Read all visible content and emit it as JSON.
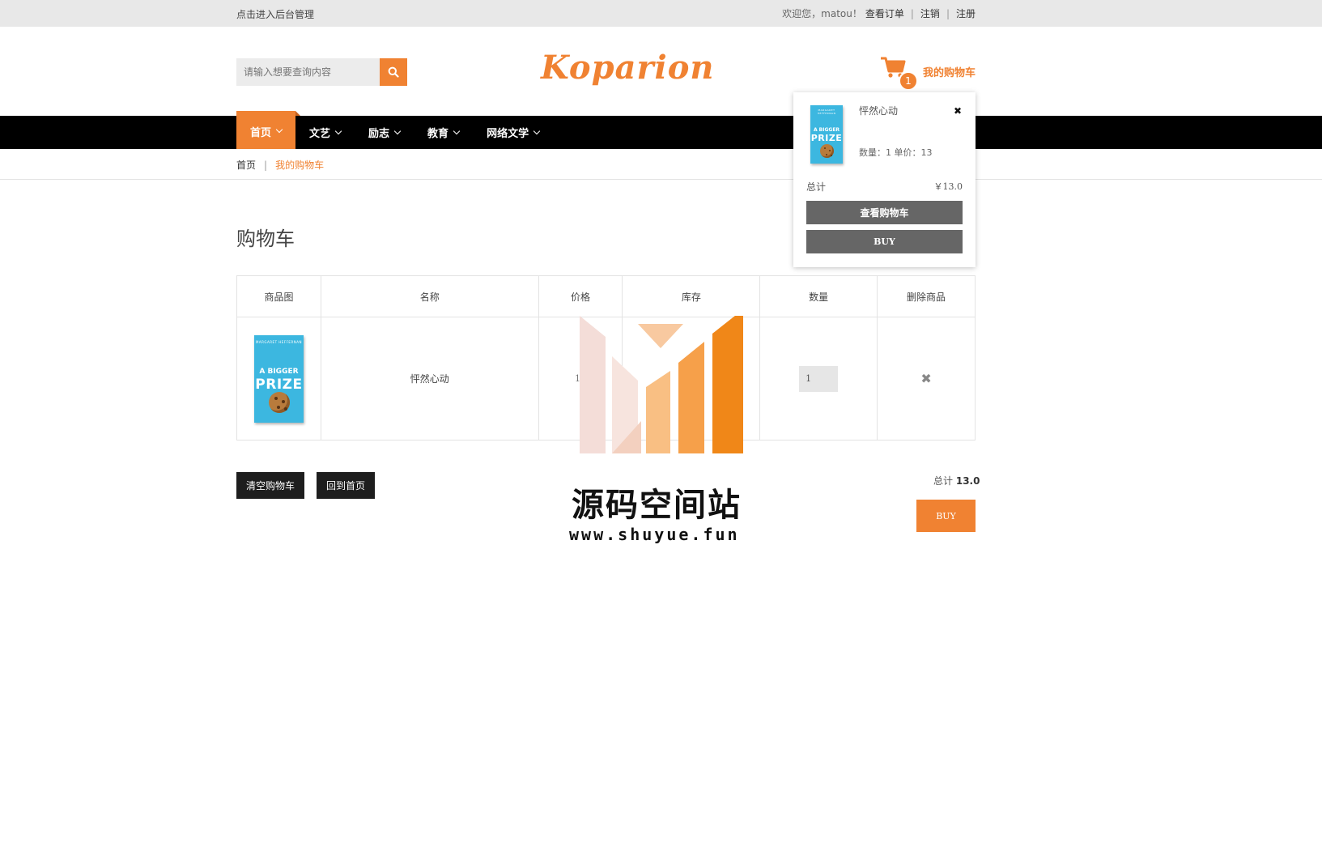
{
  "topbar": {
    "admin_link": "点击进入后台管理",
    "welcome": "欢迎您，matou！",
    "orders": "查看订单",
    "logout": "注销",
    "register": "注册"
  },
  "header": {
    "search_placeholder": "请输入想要查询内容",
    "logo": "Koparion",
    "cart_label": "我的购物车",
    "cart_count": "1"
  },
  "nav": {
    "items": [
      {
        "label": "首页"
      },
      {
        "label": "文艺"
      },
      {
        "label": "励志"
      },
      {
        "label": "教育"
      },
      {
        "label": "网络文学"
      }
    ]
  },
  "breadcrumb": {
    "home": "首页",
    "current": "我的购物车"
  },
  "page_title": "购物车",
  "table": {
    "headers": [
      "商品图",
      "名称",
      "价格",
      "库存",
      "数量",
      "删除商品"
    ],
    "rows": [
      {
        "name": "怦然心动",
        "price": "13",
        "stock": "",
        "qty": "1"
      }
    ]
  },
  "book_cover": {
    "author": "MARGARET HEFFERNAN",
    "line1": "A BIGGER",
    "line2": "PRIZE"
  },
  "actions": {
    "clear": "清空购物车",
    "home": "回到首页",
    "total_label": "总计",
    "total_value": "13.0",
    "buy": "BUY"
  },
  "minicart": {
    "item_name": "怦然心动",
    "qty_price": "数量：1  单价：13",
    "total_label": "总计",
    "total_value": "￥13.0",
    "view_cart": "查看购物车",
    "buy": "BUY"
  },
  "watermark": {
    "title": "源码空间站",
    "url": "www.shuyue.fun"
  },
  "colors": {
    "accent": "#f08232",
    "nav_bg": "#000000",
    "topbar_bg": "#e8e8e8"
  }
}
